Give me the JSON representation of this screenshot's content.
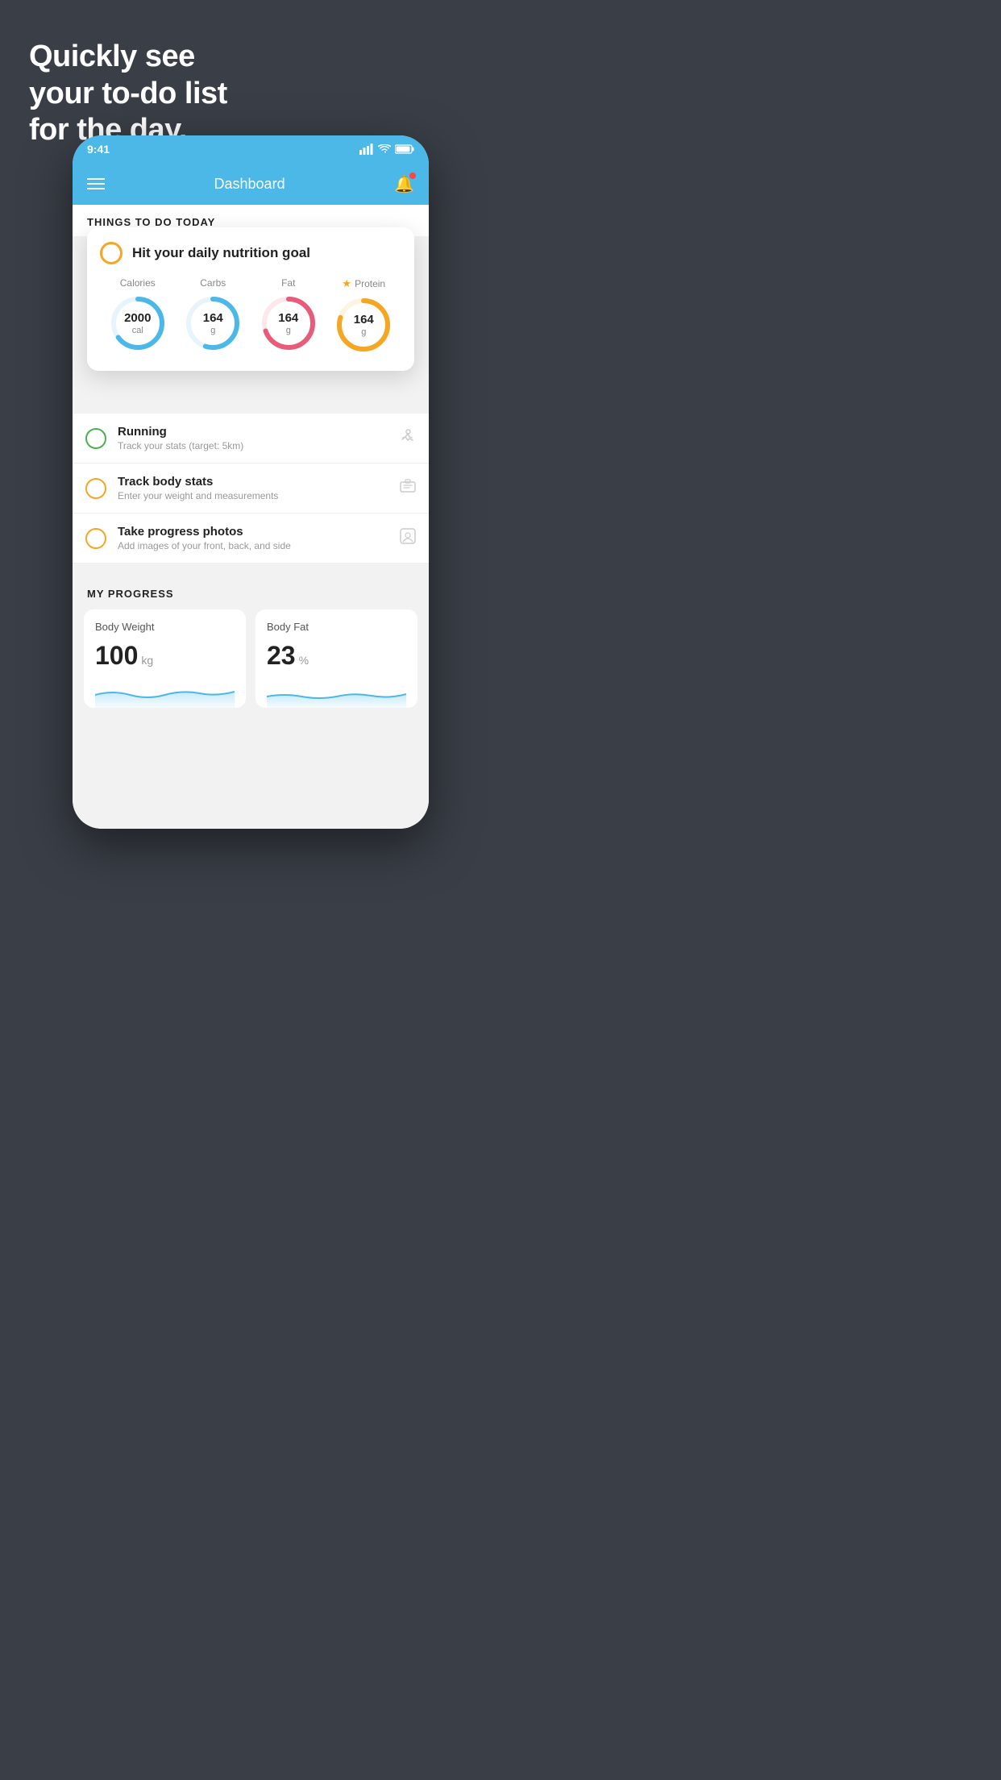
{
  "headline": {
    "line1": "Quickly see",
    "line2": "your to-do list",
    "line3": "for the day."
  },
  "status_bar": {
    "time": "9:41",
    "signal": "▋▋▋▋",
    "wifi": "wifi",
    "battery": "battery"
  },
  "nav": {
    "title": "Dashboard"
  },
  "things_section": {
    "header": "THINGS TO DO TODAY"
  },
  "nutrition_card": {
    "title": "Hit your daily nutrition goal",
    "macros": [
      {
        "label": "Calories",
        "value": "2000",
        "unit": "cal",
        "color": "#4bb8e8",
        "progress": 0.65,
        "star": false
      },
      {
        "label": "Carbs",
        "value": "164",
        "unit": "g",
        "color": "#4bb8e8",
        "progress": 0.55,
        "star": false
      },
      {
        "label": "Fat",
        "value": "164",
        "unit": "g",
        "color": "#e85c7a",
        "progress": 0.7,
        "star": false
      },
      {
        "label": "Protein",
        "value": "164",
        "unit": "g",
        "color": "#f5a623",
        "progress": 0.8,
        "star": true
      }
    ]
  },
  "todo_items": [
    {
      "title": "Running",
      "subtitle": "Track your stats (target: 5km)",
      "check_color": "green",
      "icon": "👟"
    },
    {
      "title": "Track body stats",
      "subtitle": "Enter your weight and measurements",
      "check_color": "yellow",
      "icon": "⚖️"
    },
    {
      "title": "Take progress photos",
      "subtitle": "Add images of your front, back, and side",
      "check_color": "yellow",
      "icon": "👤"
    }
  ],
  "progress_section": {
    "header": "MY PROGRESS",
    "cards": [
      {
        "title": "Body Weight",
        "value": "100",
        "unit": "kg"
      },
      {
        "title": "Body Fat",
        "value": "23",
        "unit": "%"
      }
    ]
  }
}
